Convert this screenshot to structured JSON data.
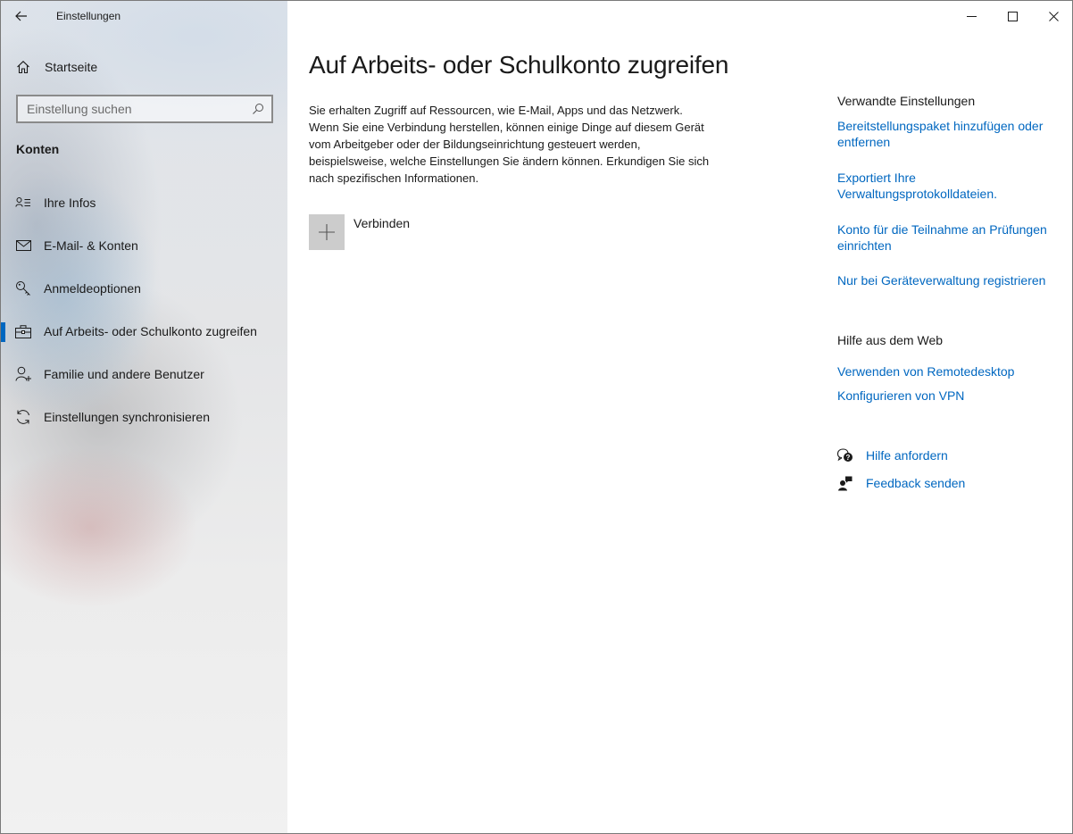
{
  "window": {
    "title": "Einstellungen"
  },
  "sidebar": {
    "home_label": "Startseite",
    "search": {
      "placeholder": "Einstellung suchen",
      "value": ""
    },
    "section_title": "Konten",
    "items": [
      {
        "label": "Ihre Infos",
        "icon": "contact-card-icon"
      },
      {
        "label": "E-Mail- & Konten",
        "icon": "mail-icon"
      },
      {
        "label": "Anmeldeoptionen",
        "icon": "key-icon"
      },
      {
        "label": "Auf Arbeits- oder Schulkonto zugreifen",
        "icon": "briefcase-icon",
        "selected": true
      },
      {
        "label": "Familie und andere Benutzer",
        "icon": "add-person-icon"
      },
      {
        "label": "Einstellungen synchronisieren",
        "icon": "sync-icon"
      }
    ]
  },
  "main": {
    "title": "Auf Arbeits- oder Schulkonto zugreifen",
    "description": "Sie erhalten Zugriff auf Ressourcen, wie E-Mail, Apps und das Netzwerk. Wenn Sie eine Verbindung herstellen, können einige Dinge auf diesem Gerät vom Arbeitgeber oder der Bildungseinrichtung gesteuert werden, beispielsweise, welche Einstellungen Sie ändern können. Erkundigen Sie sich nach spezifischen Informationen.",
    "connect_label": "Verbinden"
  },
  "related": {
    "heading": "Verwandte Einstellungen",
    "links": [
      "Bereitstellungspaket hinzufügen oder entfernen",
      "Exportiert Ihre Verwaltungsprotokolldateien.",
      "Konto für die Teilnahme an Prüfungen einrichten",
      "Nur bei Geräteverwaltung registrieren"
    ]
  },
  "web_help": {
    "heading": "Hilfe aus dem Web",
    "links": [
      "Verwenden von Remotedesktop",
      "Konfigurieren von VPN"
    ]
  },
  "support": {
    "get_help": "Hilfe anfordern",
    "feedback": "Feedback senden"
  },
  "colors": {
    "accent": "#0067c0",
    "tile": "#cccccc"
  }
}
